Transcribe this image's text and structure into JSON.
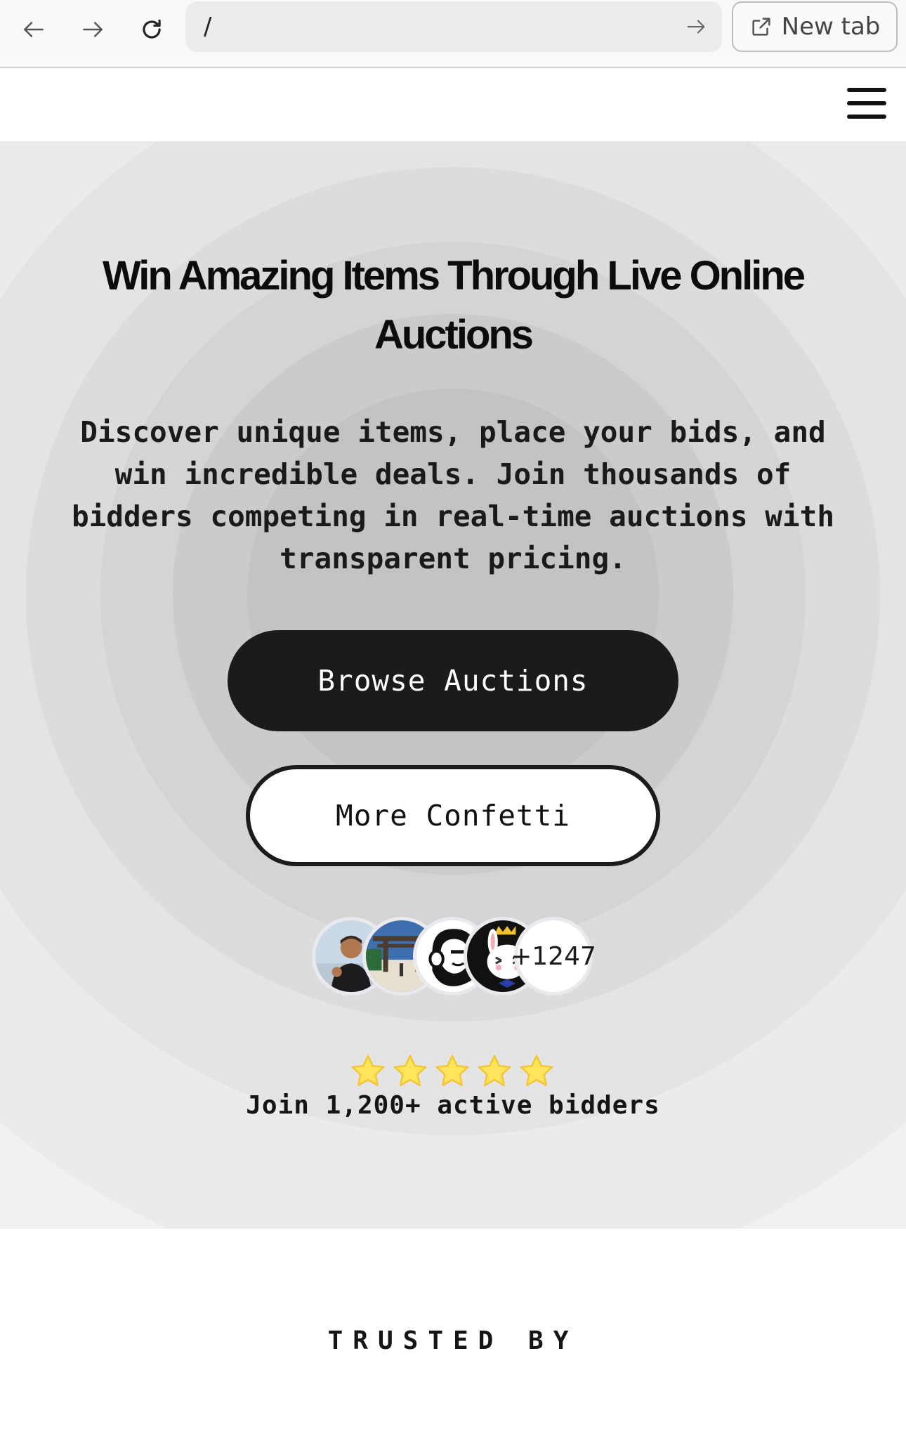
{
  "browser": {
    "url": "/",
    "new_tab_label": "New tab",
    "icons": [
      "back-arrow-icon",
      "forward-arrow-icon",
      "reload-icon",
      "go-arrow-icon",
      "external-link-icon"
    ]
  },
  "header": {
    "menu_icon": "hamburger-menu-icon"
  },
  "hero": {
    "title": "Win Amazing Items Through Live Online Auctions",
    "description": "Discover unique items, place your bids, and win incredible deals. Join thousands of bidders competing in real-time auctions with transparent pricing.",
    "primary_button": "Browse Auctions",
    "secondary_button": "More Confetti",
    "avatar_overflow_count": "+1247",
    "rating_stars": 5,
    "bidders_text": "Join 1,200+ active bidders",
    "colors": {
      "primary_button_bg": "#1b1b1d",
      "star": "#ffe45c"
    }
  },
  "trusted": {
    "label": "TRUSTED BY"
  }
}
